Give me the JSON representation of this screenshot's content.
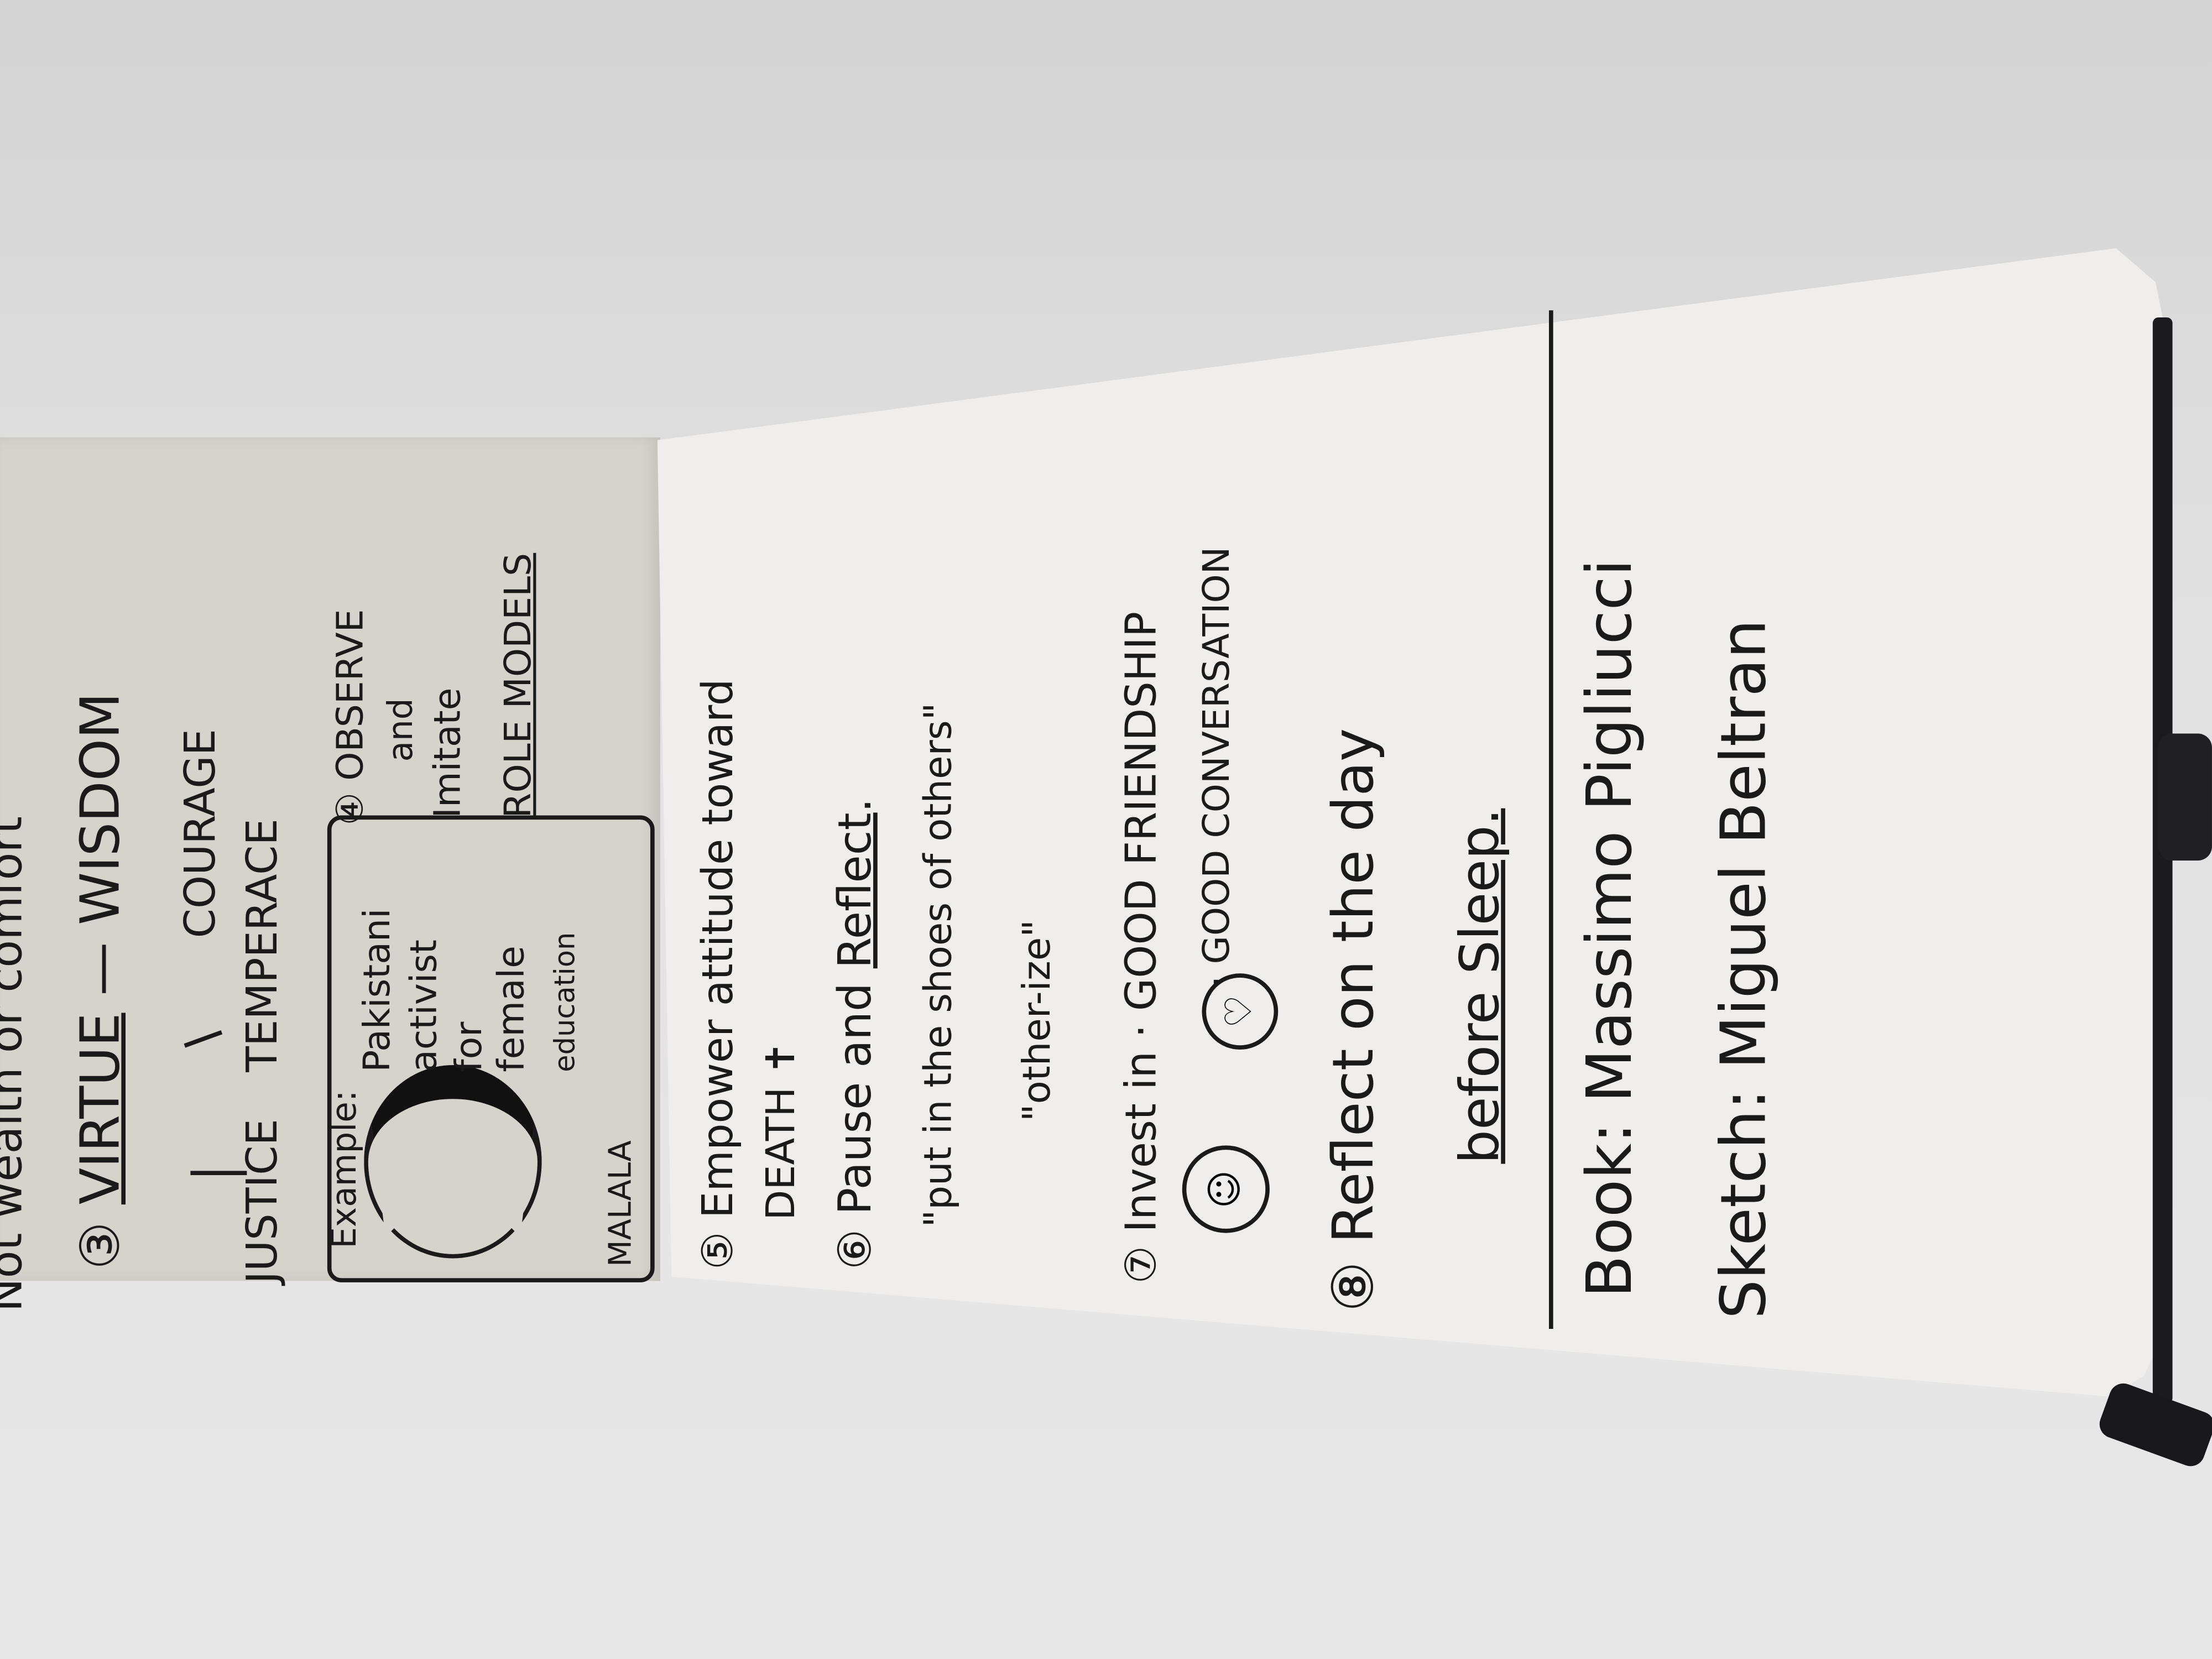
{
  "left_page": {
    "top_line": "Not wealth or comfort",
    "virtue_number": "③",
    "virtue": "VIRTUE",
    "virtue_dash": "— WISDOM",
    "courage": "COURAGE",
    "justice": "JUSTICE",
    "temperance": "TEMPERACE",
    "example_label": "Example:",
    "example_lines": [
      "Pakistani",
      "activist",
      "for",
      "female",
      "education"
    ],
    "example_name": "MALALA",
    "observe_number": "④",
    "observe_lines": [
      "OBSERVE",
      "and",
      "Imitate"
    ],
    "role_models": "ROLE MODELS"
  },
  "right_page": {
    "item5": "⑤ Empower attitude toward",
    "item5_cont": "DEATH ✝",
    "item6_prefix": "⑥ Pause and ",
    "item6_reflect": "Reflect",
    "item6_suffix": ".",
    "quote1": "\"put in the shoes of others\"",
    "quote2": "\"other-ize\"",
    "item7": "⑦ Invest in · GOOD FRIENDSHIP",
    "item7_cont": "· GOOD CONVERSATION",
    "smiley_icon": "☺",
    "heart_icon": "♡",
    "item8": "⑧ Reflect on the day",
    "item8_cont": "before Sleep.",
    "book": "Book: Massimo Pigliucci",
    "sketch": "Sketch: Miguel Beltran"
  },
  "colors": {
    "ink": "#1a1a1a",
    "paper": "#efeeec",
    "left_paper": "#d6d3cd"
  }
}
